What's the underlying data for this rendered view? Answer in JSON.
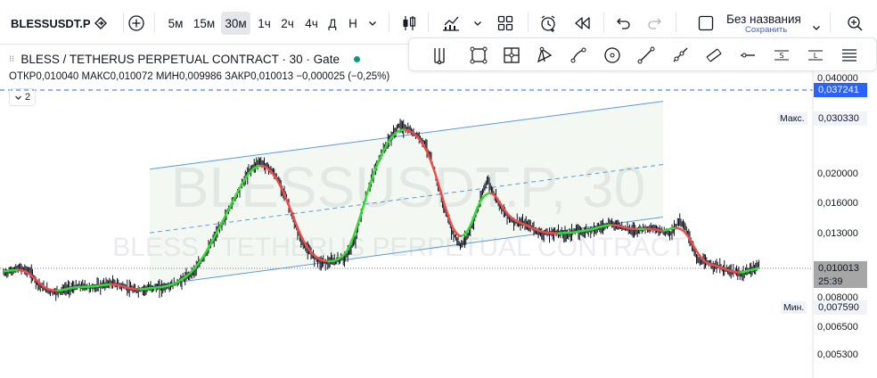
{
  "toolbar": {
    "symbol": "BLESSUSDT.P",
    "timeframes": [
      "5м",
      "15м",
      "30м",
      "1ч",
      "2ч",
      "4ч",
      "Д",
      "Н"
    ],
    "active_timeframe": "30м",
    "layout_title": "Без названия",
    "layout_saved": "Сохранить",
    "icons": [
      "watchlist-icon",
      "add-symbol-icon",
      "dropdown-icon",
      "candles-icon",
      "indicators-icon",
      "templates-icon",
      "alert-icon",
      "replay-icon",
      "undo-icon",
      "redo-icon",
      "layout-icon",
      "fullscreen-icon"
    ]
  },
  "drawing_tools": [
    "pitchfork-icon",
    "rectangle-icon",
    "gann-box-icon",
    "triangle-icon",
    "curve-icon",
    "circle-icon",
    "trend-line-icon",
    "ray-icon",
    "parallel-channel-icon",
    "horizontal-ray-icon",
    "regression-trend-icon",
    "fib-lines-icon",
    "hamburger-icon"
  ],
  "legend": {
    "title": "BLESS / TETHERUS PERPETUAL CONTRACT · 30 · Gate",
    "open_label": "ОТКР",
    "open": "0,010040",
    "high_label": "МАКС",
    "high": "0,010072",
    "low_label": "МИН",
    "low": "0,009986",
    "close_label": "ЗАКР",
    "close": "0,010013",
    "change": "−0,000025 (−0,25%)",
    "collapse_count": "2"
  },
  "watermark": {
    "big": "BLESSUSDT.P, 30",
    "small": "BLESS / TETHERUS PERPETUAL CONTRACT"
  },
  "price_scale": {
    "ticks": [
      "0,040000",
      "0,020000",
      "0,016000",
      "0,013000",
      "0,008000",
      "0,006500",
      "0,005300"
    ],
    "hline_price": "0,037241",
    "max_label": "Макс.",
    "max_price": "0,030330",
    "last_price": "0,010013",
    "countdown": "25:39",
    "min_label": "Мин.",
    "min_price": "0,007590"
  },
  "colors": {
    "accent": "#2962ff",
    "hline": "#2962ff",
    "channel": "#5b9bd5",
    "up_trend": "#33dd33",
    "down_trend": "#f04a4a",
    "candle": "#131722",
    "last_price_bg": "#a6a6a6",
    "live_dot": "#089981"
  },
  "chart_data": {
    "type": "line",
    "scale": "log",
    "ylim": [
      0.0048,
      0.0435
    ],
    "series": [
      {
        "values": [
          0.0093,
          0.0095,
          0.0097,
          0.0094,
          0.0085,
          0.0081,
          0.008,
          0.0082,
          0.0083,
          0.0084,
          0.0083,
          0.0084,
          0.0086,
          0.0085,
          0.0083,
          0.0081,
          0.0082,
          0.0083,
          0.0083,
          0.0084,
          0.0087,
          0.0091,
          0.0097,
          0.0108,
          0.0123,
          0.014,
          0.0162,
          0.0185,
          0.021,
          0.0225,
          0.0218,
          0.02,
          0.0175,
          0.014,
          0.0118,
          0.0108,
          0.0102,
          0.0101,
          0.0103,
          0.0106,
          0.012,
          0.016,
          0.02,
          0.024,
          0.027,
          0.03,
          0.029,
          0.0278,
          0.026,
          0.021,
          0.016,
          0.013,
          0.0115,
          0.0128,
          0.0155,
          0.0195,
          0.017,
          0.015,
          0.014,
          0.0138,
          0.0135,
          0.0128,
          0.0127,
          0.0129,
          0.0126,
          0.013,
          0.0129,
          0.0132,
          0.0134,
          0.0138,
          0.0136,
          0.0132,
          0.0131,
          0.0133,
          0.0132,
          0.013,
          0.0128,
          0.0142,
          0.0125,
          0.0102,
          0.0101,
          0.0099,
          0.0096,
          0.0094,
          0.0092,
          0.0095,
          0.01
        ]
      }
    ],
    "channel": {
      "upper": [
        [
          168,
          0.0212
        ],
        [
          744,
          0.0363
        ]
      ],
      "middle": [
        [
          168,
          0.0128
        ],
        [
          744,
          0.022
        ]
      ],
      "lower": [
        [
          168,
          0.0084
        ],
        [
          744,
          0.0145
        ]
      ]
    }
  }
}
